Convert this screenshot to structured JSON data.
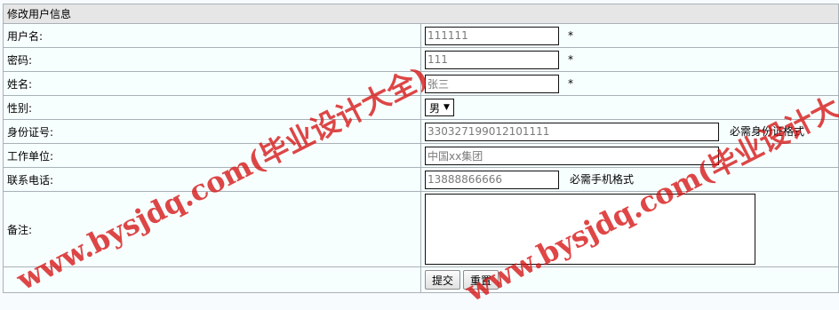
{
  "form": {
    "title": "修改用户信息",
    "fields": {
      "username": {
        "label": "用户名:",
        "value": "111111",
        "required_mark": "*"
      },
      "password": {
        "label": "密码:",
        "value": "111",
        "required_mark": "*"
      },
      "name": {
        "label": "姓名:",
        "value": "张三",
        "required_mark": "*"
      },
      "gender": {
        "label": "性别:",
        "selected": "男"
      },
      "id_card": {
        "label": "身份证号:",
        "value": "330327199012101111",
        "hint": "必需身份证格式"
      },
      "work_unit": {
        "label": "工作单位:",
        "value": "中国xx集团"
      },
      "phone": {
        "label": "联系电话:",
        "value": "13888866666",
        "hint": "必需手机格式"
      },
      "remark": {
        "label": "备注:",
        "value": ""
      }
    },
    "buttons": {
      "submit": "提交",
      "reset": "重置"
    }
  },
  "watermarks": [
    "www.bysjdq.com(毕业设计大全)",
    "www.bysjdq.com(毕业设计大"
  ],
  "colors": {
    "title_bg": "#e6e6e6",
    "row_bg": "#f7fefe",
    "border": "#a9b2b8",
    "watermark": "#d61212"
  }
}
